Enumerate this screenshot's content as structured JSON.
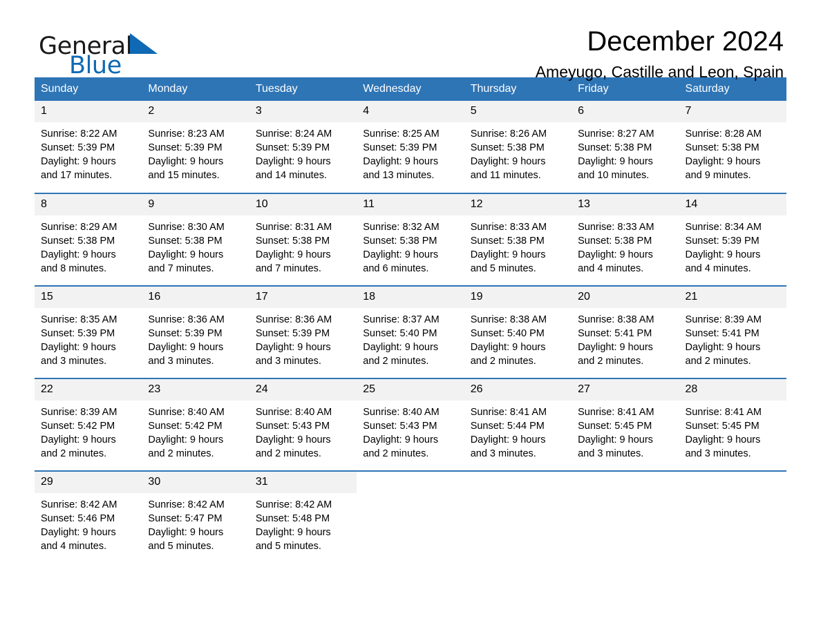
{
  "brand": {
    "name_part1": "General",
    "name_part2": "Blue",
    "logo_icon": "triangle-logo-icon",
    "accent_color": "#1069b4"
  },
  "header": {
    "title": "December 2024",
    "subtitle": "Ameyugo, Castille and Leon, Spain"
  },
  "theme": {
    "header_bg": "#2e75b6",
    "daynum_bg": "#f2f2f2",
    "rule_color": "#2e75b6"
  },
  "calendar": {
    "weekdays": [
      "Sunday",
      "Monday",
      "Tuesday",
      "Wednesday",
      "Thursday",
      "Friday",
      "Saturday"
    ],
    "weeks": [
      [
        {
          "day": "1",
          "sunrise": "Sunrise: 8:22 AM",
          "sunset": "Sunset: 5:39 PM",
          "daylight1": "Daylight: 9 hours",
          "daylight2": "and 17 minutes."
        },
        {
          "day": "2",
          "sunrise": "Sunrise: 8:23 AM",
          "sunset": "Sunset: 5:39 PM",
          "daylight1": "Daylight: 9 hours",
          "daylight2": "and 15 minutes."
        },
        {
          "day": "3",
          "sunrise": "Sunrise: 8:24 AM",
          "sunset": "Sunset: 5:39 PM",
          "daylight1": "Daylight: 9 hours",
          "daylight2": "and 14 minutes."
        },
        {
          "day": "4",
          "sunrise": "Sunrise: 8:25 AM",
          "sunset": "Sunset: 5:39 PM",
          "daylight1": "Daylight: 9 hours",
          "daylight2": "and 13 minutes."
        },
        {
          "day": "5",
          "sunrise": "Sunrise: 8:26 AM",
          "sunset": "Sunset: 5:38 PM",
          "daylight1": "Daylight: 9 hours",
          "daylight2": "and 11 minutes."
        },
        {
          "day": "6",
          "sunrise": "Sunrise: 8:27 AM",
          "sunset": "Sunset: 5:38 PM",
          "daylight1": "Daylight: 9 hours",
          "daylight2": "and 10 minutes."
        },
        {
          "day": "7",
          "sunrise": "Sunrise: 8:28 AM",
          "sunset": "Sunset: 5:38 PM",
          "daylight1": "Daylight: 9 hours",
          "daylight2": "and 9 minutes."
        }
      ],
      [
        {
          "day": "8",
          "sunrise": "Sunrise: 8:29 AM",
          "sunset": "Sunset: 5:38 PM",
          "daylight1": "Daylight: 9 hours",
          "daylight2": "and 8 minutes."
        },
        {
          "day": "9",
          "sunrise": "Sunrise: 8:30 AM",
          "sunset": "Sunset: 5:38 PM",
          "daylight1": "Daylight: 9 hours",
          "daylight2": "and 7 minutes."
        },
        {
          "day": "10",
          "sunrise": "Sunrise: 8:31 AM",
          "sunset": "Sunset: 5:38 PM",
          "daylight1": "Daylight: 9 hours",
          "daylight2": "and 7 minutes."
        },
        {
          "day": "11",
          "sunrise": "Sunrise: 8:32 AM",
          "sunset": "Sunset: 5:38 PM",
          "daylight1": "Daylight: 9 hours",
          "daylight2": "and 6 minutes."
        },
        {
          "day": "12",
          "sunrise": "Sunrise: 8:33 AM",
          "sunset": "Sunset: 5:38 PM",
          "daylight1": "Daylight: 9 hours",
          "daylight2": "and 5 minutes."
        },
        {
          "day": "13",
          "sunrise": "Sunrise: 8:33 AM",
          "sunset": "Sunset: 5:38 PM",
          "daylight1": "Daylight: 9 hours",
          "daylight2": "and 4 minutes."
        },
        {
          "day": "14",
          "sunrise": "Sunrise: 8:34 AM",
          "sunset": "Sunset: 5:39 PM",
          "daylight1": "Daylight: 9 hours",
          "daylight2": "and 4 minutes."
        }
      ],
      [
        {
          "day": "15",
          "sunrise": "Sunrise: 8:35 AM",
          "sunset": "Sunset: 5:39 PM",
          "daylight1": "Daylight: 9 hours",
          "daylight2": "and 3 minutes."
        },
        {
          "day": "16",
          "sunrise": "Sunrise: 8:36 AM",
          "sunset": "Sunset: 5:39 PM",
          "daylight1": "Daylight: 9 hours",
          "daylight2": "and 3 minutes."
        },
        {
          "day": "17",
          "sunrise": "Sunrise: 8:36 AM",
          "sunset": "Sunset: 5:39 PM",
          "daylight1": "Daylight: 9 hours",
          "daylight2": "and 3 minutes."
        },
        {
          "day": "18",
          "sunrise": "Sunrise: 8:37 AM",
          "sunset": "Sunset: 5:40 PM",
          "daylight1": "Daylight: 9 hours",
          "daylight2": "and 2 minutes."
        },
        {
          "day": "19",
          "sunrise": "Sunrise: 8:38 AM",
          "sunset": "Sunset: 5:40 PM",
          "daylight1": "Daylight: 9 hours",
          "daylight2": "and 2 minutes."
        },
        {
          "day": "20",
          "sunrise": "Sunrise: 8:38 AM",
          "sunset": "Sunset: 5:41 PM",
          "daylight1": "Daylight: 9 hours",
          "daylight2": "and 2 minutes."
        },
        {
          "day": "21",
          "sunrise": "Sunrise: 8:39 AM",
          "sunset": "Sunset: 5:41 PM",
          "daylight1": "Daylight: 9 hours",
          "daylight2": "and 2 minutes."
        }
      ],
      [
        {
          "day": "22",
          "sunrise": "Sunrise: 8:39 AM",
          "sunset": "Sunset: 5:42 PM",
          "daylight1": "Daylight: 9 hours",
          "daylight2": "and 2 minutes."
        },
        {
          "day": "23",
          "sunrise": "Sunrise: 8:40 AM",
          "sunset": "Sunset: 5:42 PM",
          "daylight1": "Daylight: 9 hours",
          "daylight2": "and 2 minutes."
        },
        {
          "day": "24",
          "sunrise": "Sunrise: 8:40 AM",
          "sunset": "Sunset: 5:43 PM",
          "daylight1": "Daylight: 9 hours",
          "daylight2": "and 2 minutes."
        },
        {
          "day": "25",
          "sunrise": "Sunrise: 8:40 AM",
          "sunset": "Sunset: 5:43 PM",
          "daylight1": "Daylight: 9 hours",
          "daylight2": "and 2 minutes."
        },
        {
          "day": "26",
          "sunrise": "Sunrise: 8:41 AM",
          "sunset": "Sunset: 5:44 PM",
          "daylight1": "Daylight: 9 hours",
          "daylight2": "and 3 minutes."
        },
        {
          "day": "27",
          "sunrise": "Sunrise: 8:41 AM",
          "sunset": "Sunset: 5:45 PM",
          "daylight1": "Daylight: 9 hours",
          "daylight2": "and 3 minutes."
        },
        {
          "day": "28",
          "sunrise": "Sunrise: 8:41 AM",
          "sunset": "Sunset: 5:45 PM",
          "daylight1": "Daylight: 9 hours",
          "daylight2": "and 3 minutes."
        }
      ],
      [
        {
          "day": "29",
          "sunrise": "Sunrise: 8:42 AM",
          "sunset": "Sunset: 5:46 PM",
          "daylight1": "Daylight: 9 hours",
          "daylight2": "and 4 minutes."
        },
        {
          "day": "30",
          "sunrise": "Sunrise: 8:42 AM",
          "sunset": "Sunset: 5:47 PM",
          "daylight1": "Daylight: 9 hours",
          "daylight2": "and 5 minutes."
        },
        {
          "day": "31",
          "sunrise": "Sunrise: 8:42 AM",
          "sunset": "Sunset: 5:48 PM",
          "daylight1": "Daylight: 9 hours",
          "daylight2": "and 5 minutes."
        },
        {
          "day": "",
          "sunrise": "",
          "sunset": "",
          "daylight1": "",
          "daylight2": ""
        },
        {
          "day": "",
          "sunrise": "",
          "sunset": "",
          "daylight1": "",
          "daylight2": ""
        },
        {
          "day": "",
          "sunrise": "",
          "sunset": "",
          "daylight1": "",
          "daylight2": ""
        },
        {
          "day": "",
          "sunrise": "",
          "sunset": "",
          "daylight1": "",
          "daylight2": ""
        }
      ]
    ]
  }
}
